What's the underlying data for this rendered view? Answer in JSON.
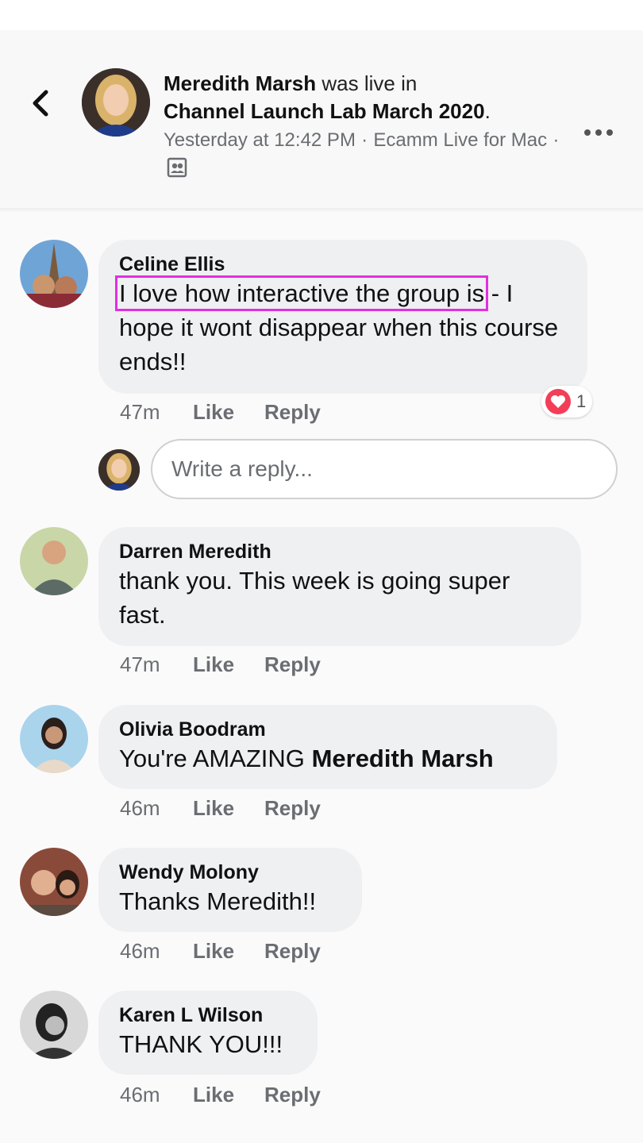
{
  "header": {
    "poster_name": "Meredith Marsh",
    "was_live_text": "was live in",
    "group_name": "Channel Launch Lab March 2020",
    "period": ".",
    "timestamp": "Yesterday at 12:42 PM",
    "separator": "·",
    "source": "Ecamm Live for Mac",
    "audience_icon": "group-icon"
  },
  "comments": [
    {
      "author": "Celine Ellis",
      "text_highlighted": "I love how interactive the group is",
      "text_rest": "- I hope it wont disappear when this course ends!!",
      "time": "47m",
      "like_label": "Like",
      "reply_label": "Reply",
      "reaction": {
        "type": "love",
        "count": "1"
      }
    },
    {
      "author": "Darren Meredith",
      "text": "thank you. This week is going super fast.",
      "time": "47m",
      "like_label": "Like",
      "reply_label": "Reply"
    },
    {
      "author": "Olivia Boodram",
      "text": "You're AMAZING",
      "mention": "Meredith Marsh",
      "time": "46m",
      "like_label": "Like",
      "reply_label": "Reply"
    },
    {
      "author": "Wendy Molony",
      "text": "Thanks Meredith!!",
      "time": "46m",
      "like_label": "Like",
      "reply_label": "Reply"
    },
    {
      "author": "Karen L Wilson",
      "text": "THANK YOU!!!",
      "time": "46m",
      "like_label": "Like",
      "reply_label": "Reply"
    }
  ],
  "reply_box": {
    "placeholder": "Write a reply..."
  },
  "colors": {
    "highlight": "#e22fe0",
    "love": "#f33e58",
    "bubble": "#eff0f2"
  }
}
